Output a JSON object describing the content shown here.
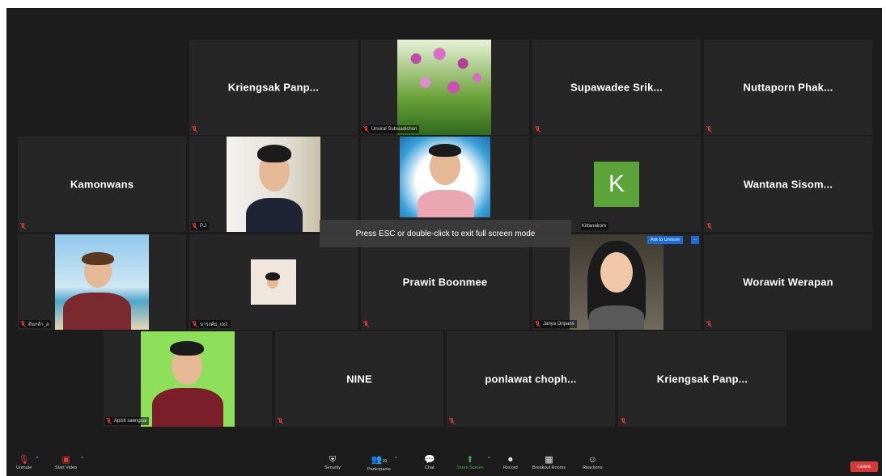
{
  "participants": [
    {
      "id": "p0",
      "name": ""
    },
    {
      "id": "p1",
      "name": "Kriengsak  Panp..."
    },
    {
      "id": "p2",
      "label": "Unsiral Subsiadichon"
    },
    {
      "id": "p3",
      "name": "Supawadee  Srik..."
    },
    {
      "id": "p4",
      "name": "Nuttaporn  Phak..."
    },
    {
      "id": "p5",
      "name": "Kamonwans"
    },
    {
      "id": "p6",
      "label": "P.J"
    },
    {
      "id": "p7",
      "label": ""
    },
    {
      "id": "p8",
      "avatar_letter": "K",
      "label": "Kittanakorn"
    },
    {
      "id": "p9",
      "name": "Wantana  Sisom..."
    },
    {
      "id": "p10",
      "label": "ต้นกล้า_a"
    },
    {
      "id": "p11",
      "label": "นารงค์ม_ux2"
    },
    {
      "id": "p12",
      "name": "Prawit Boonmee"
    },
    {
      "id": "p13",
      "label": "Janya Onpans"
    },
    {
      "id": "p14",
      "name": "Worawit Werapan"
    },
    {
      "id": "p15",
      "label": "Apisit saengsai"
    },
    {
      "id": "p16",
      "name": "NINE"
    },
    {
      "id": "p17",
      "name": "ponlawat  choph..."
    },
    {
      "id": "p18",
      "name": "Kriengsak  Panp..."
    }
  ],
  "esc_toast": "Press ESC or double-click to exit full screen mode",
  "ask_to_unmute": "Ask to Unmute",
  "toolbar": {
    "unmute": "Unmute",
    "start_video": "Start Video",
    "security": "Security",
    "participants": "Participants",
    "participants_count": "19",
    "chat": "Chat",
    "share_screen": "Share Screen",
    "record": "Record",
    "breakout": "Breakout Rooms",
    "reactions": "Reactions",
    "leave": "Leave"
  },
  "colors": {
    "mute": "#e23b3b",
    "share": "#2fb34a",
    "leave": "#d93a3a",
    "accent": "#1e6bd6"
  }
}
